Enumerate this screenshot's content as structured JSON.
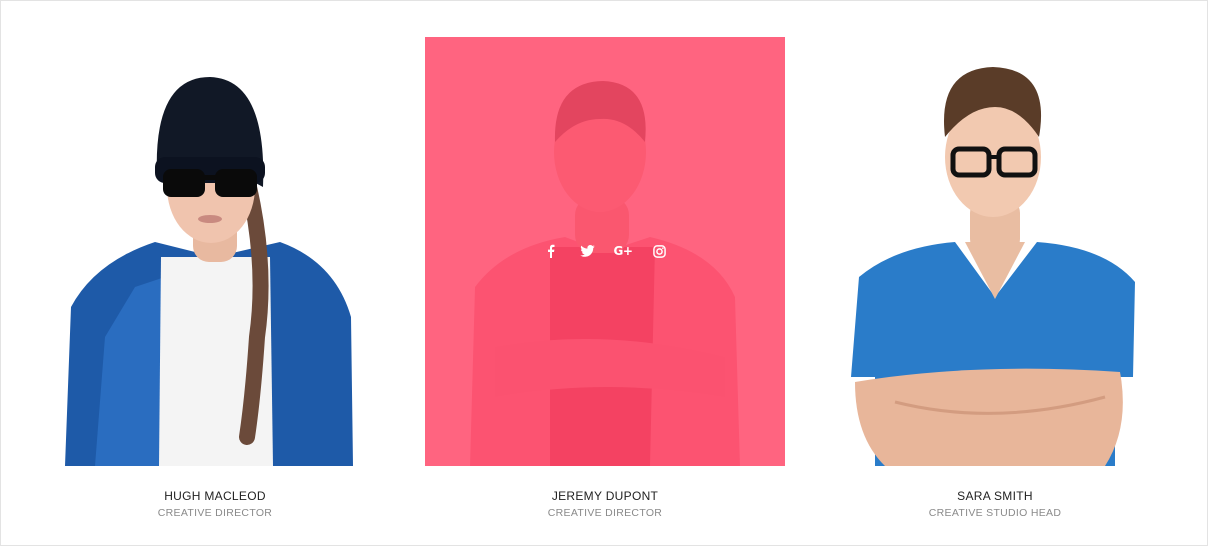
{
  "team": {
    "members": [
      {
        "name": "HUGH MACLEOD",
        "role": "CREATIVE DIRECTOR"
      },
      {
        "name": "JEREMY DUPONT",
        "role": "CREATIVE DIRECTOR"
      },
      {
        "name": "SARA SMITH",
        "role": "CREATIVE STUDIO HEAD"
      }
    ],
    "hovered_index": 1,
    "overlay_color": "#ff4a6b",
    "social_icons": [
      "facebook-icon",
      "twitter-icon",
      "google-plus-icon",
      "instagram-icon"
    ],
    "google_plus_glyph": "G+"
  }
}
